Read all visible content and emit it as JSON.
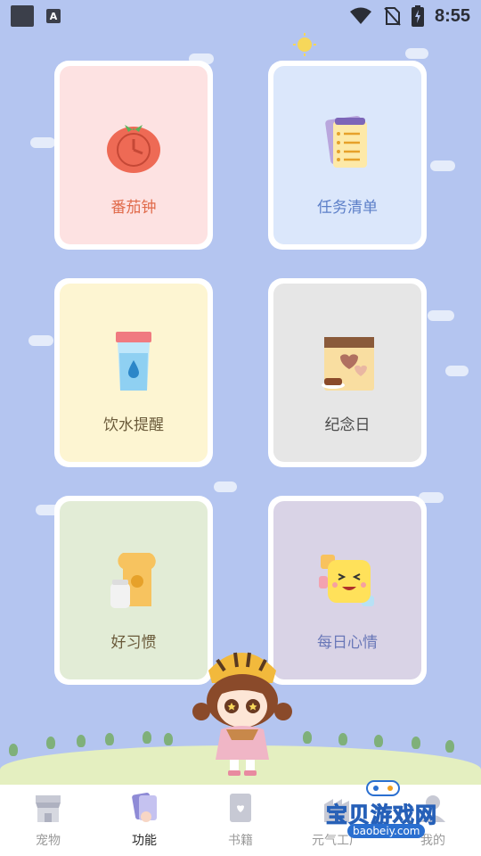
{
  "status_bar": {
    "time": "8:55",
    "notification_badge": "A"
  },
  "cards": [
    {
      "label": "番茄钟",
      "icon": "tomato-timer-icon",
      "bg": "#fde2e2",
      "color": "#e06a4a"
    },
    {
      "label": "任务清单",
      "icon": "checklist-icon",
      "bg": "#dbe7fb",
      "color": "#5c7fc8"
    },
    {
      "label": "饮水提醒",
      "icon": "water-cup-icon",
      "bg": "#fdf5d2",
      "color": "#6a5a3a"
    },
    {
      "label": "纪念日",
      "icon": "calendar-heart-icon",
      "bg": "#e6e6e6",
      "color": "#4a4a4a"
    },
    {
      "label": "好习惯",
      "icon": "bread-milk-icon",
      "bg": "#e2ecd6",
      "color": "#6a5a3a"
    },
    {
      "label": "每日心情",
      "icon": "happy-face-icon",
      "bg": "#d9d3e6",
      "color": "#6a78b8"
    }
  ],
  "bottom_nav": [
    {
      "label": "宠物",
      "icon": "shop-icon",
      "active": false
    },
    {
      "label": "功能",
      "icon": "cards-icon",
      "active": true
    },
    {
      "label": "书籍",
      "icon": "book-icon",
      "active": false
    },
    {
      "label": "元气工厂",
      "icon": "factory-icon",
      "active": false
    },
    {
      "label": "我的",
      "icon": "profile-icon",
      "active": false
    }
  ],
  "watermark": {
    "text": "宝贝游戏网",
    "url": "baobeiy.com"
  }
}
